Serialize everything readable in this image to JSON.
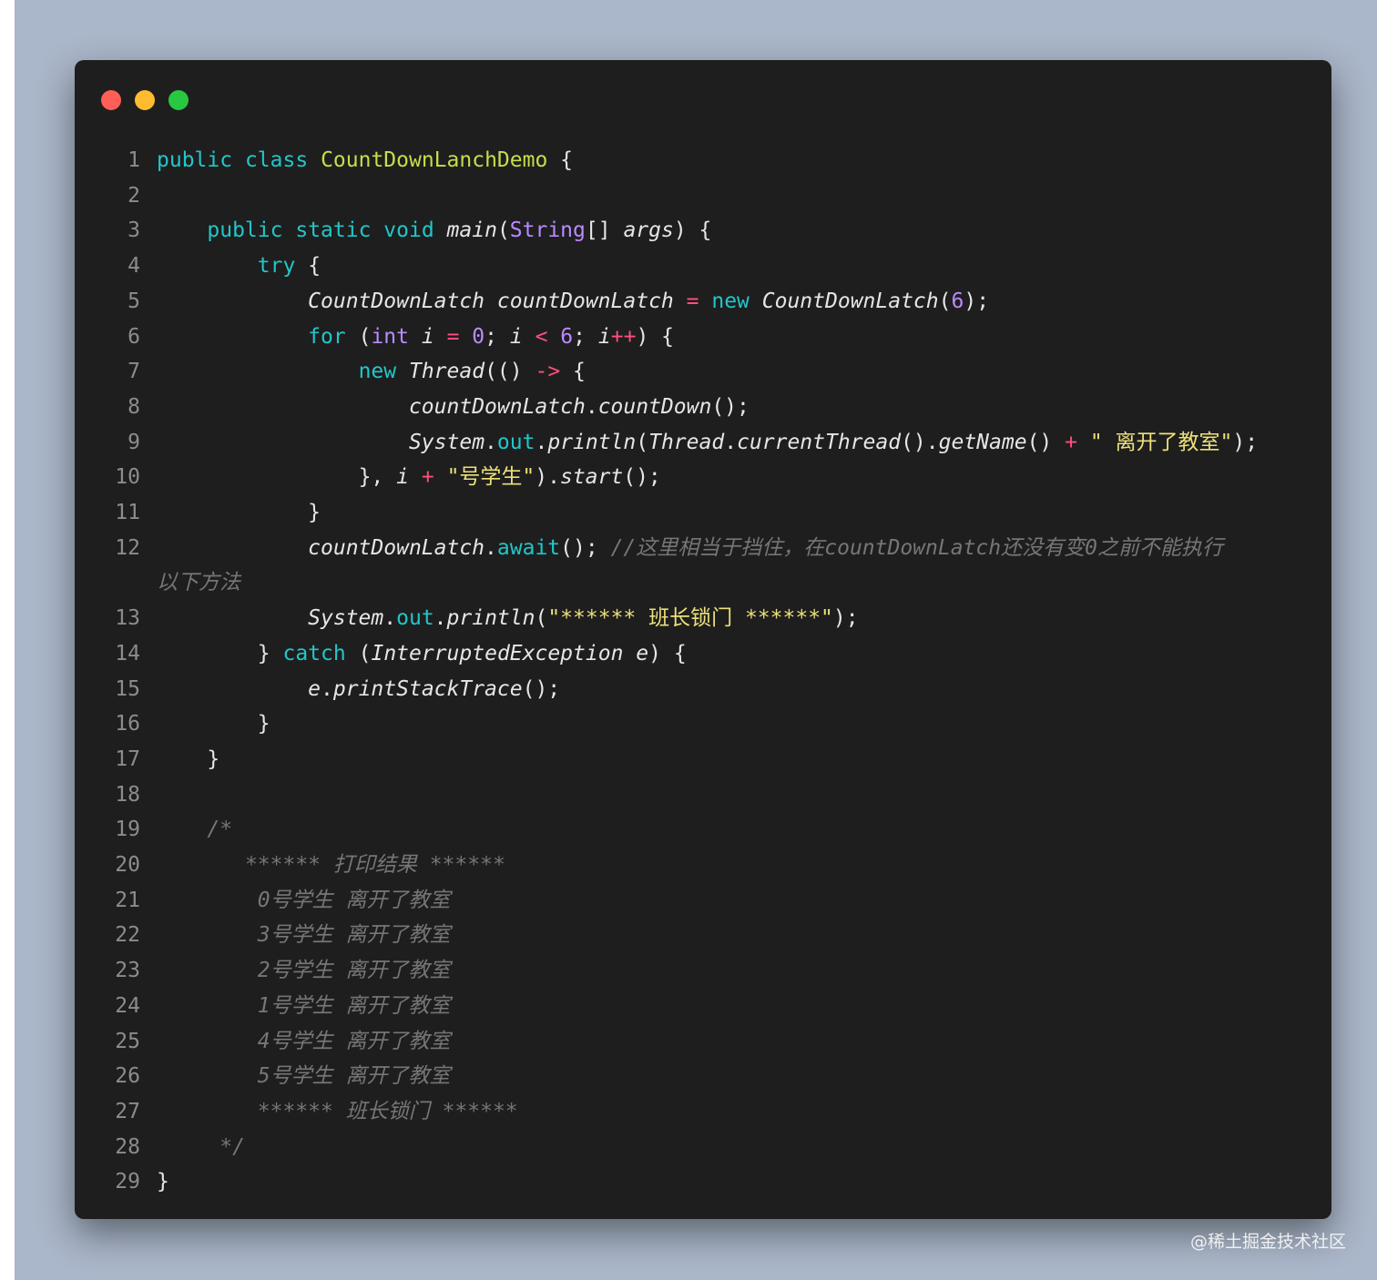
{
  "window": {
    "traffic_lights": [
      {
        "name": "close",
        "color": "#ff5f57"
      },
      {
        "name": "minimize",
        "color": "#febc2e"
      },
      {
        "name": "maximize",
        "color": "#28c840"
      }
    ]
  },
  "colors": {
    "background": "#aab6c9",
    "editor_background": "#1e1e1e",
    "keyword": "#22c6c9",
    "class_name": "#c8dd4b",
    "type": "#b98bff",
    "operator": "#ff4f7e",
    "string": "#ece07a",
    "comment": "#767676"
  },
  "code": {
    "line_numbers": [
      "1",
      "2",
      "3",
      "4",
      "5",
      "6",
      "7",
      "8",
      "9",
      "10",
      "11",
      "12",
      "13",
      "14",
      "15",
      "16",
      "17",
      "18",
      "19",
      "20",
      "21",
      "22",
      "23",
      "24",
      "25",
      "26",
      "27",
      "28",
      "29"
    ],
    "tokens": {
      "public": "public",
      "class": "class",
      "class_name": "CountDownLanchDemo",
      "brace_open": "{",
      "brace_close": "}",
      "static": "static",
      "void": "void",
      "main": "main",
      "lparen": "(",
      "string_type": "String",
      "array_brackets": "[]",
      "args": "args",
      "rparen_brace": ") {",
      "try": "try",
      "cdl_type": "CountDownLatch",
      "cdl_var": "countDownLatch",
      "assign": "=",
      "new": "new",
      "cdl_ctor": "CountDownLatch",
      "six": "6",
      "close_semi": ");",
      "for": "for",
      "int": "int",
      "i": "i",
      "zero": "0",
      "semi": ";",
      "lt": "<",
      "inc": "++",
      "thread": "Thread",
      "lambda_open": "(()",
      "arrow": "->",
      "dot": ".",
      "countDown": "countDown",
      "empty_call_semi": "();",
      "system": "System",
      "out": "out",
      "println": "println",
      "currentThread": "currentThread",
      "empty_call": "()",
      "getName": "getName",
      "plus": "+",
      "str_leave": "\" 离开了教室\"",
      "close_lambda": "},",
      "str_student": "\"号学生\"",
      "start": "start",
      "await": "await",
      "comment_12_a": "//这里相当于挡住，在countDownLatch还没有变0之前不能执行",
      "comment_12_b": "以下方法",
      "str_monitor": "\"****** 班长锁门 ******\"",
      "catch": "catch",
      "interrupted": "InterruptedException",
      "e": "e",
      "printStackTrace": "printStackTrace",
      "comment_open": "/*",
      "comment_20": "****** 打印结果 ******",
      "comment_21": "0号学生 离开了教室",
      "comment_22": "3号学生 离开了教室",
      "comment_23": "2号学生 离开了教室",
      "comment_24": "1号学生 离开了教室",
      "comment_25": "4号学生 离开了教室",
      "comment_26": "5号学生 离开了教室",
      "comment_27": "****** 班长锁门 ******",
      "comment_close": "*/"
    }
  },
  "watermark": "@稀土掘金技术社区"
}
